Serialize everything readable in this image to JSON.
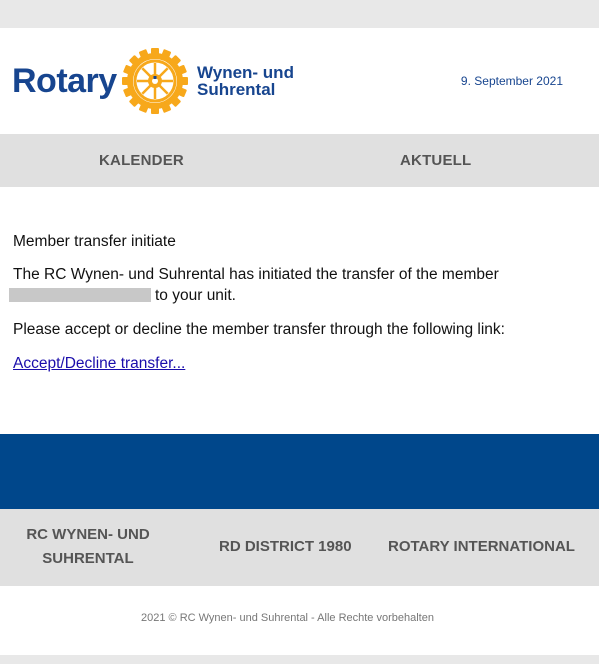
{
  "header": {
    "logo_word": "Rotary",
    "club_line1": "Wynen- und",
    "club_line2": "Suhrental",
    "date": "9. September 2021"
  },
  "nav": {
    "items": [
      {
        "label": "KALENDER"
      },
      {
        "label": "AKTUELL"
      }
    ]
  },
  "message": {
    "title": "Member transfer initiate",
    "body_prefix": "The RC Wynen- und Suhrental has initiated the transfer of the member",
    "body_suffix": "to your unit.",
    "instruction": "Please accept or decline the member transfer through the following link:",
    "link_label": "Accept/Decline transfer..."
  },
  "footer": {
    "links": [
      {
        "line1": "RC WYNEN- UND",
        "line2": "SUHRENTAL"
      },
      {
        "label": "RD DISTRICT 1980"
      },
      {
        "label": "ROTARY INTERNATIONAL"
      }
    ],
    "copyright": "2021 © RC Wynen- und Suhrental - Alle Rechte vorbehalten"
  },
  "colors": {
    "brand_blue": "#17458f",
    "band_blue": "#00478b",
    "gold": "#f7a81b",
    "link": "#1a0dab"
  }
}
